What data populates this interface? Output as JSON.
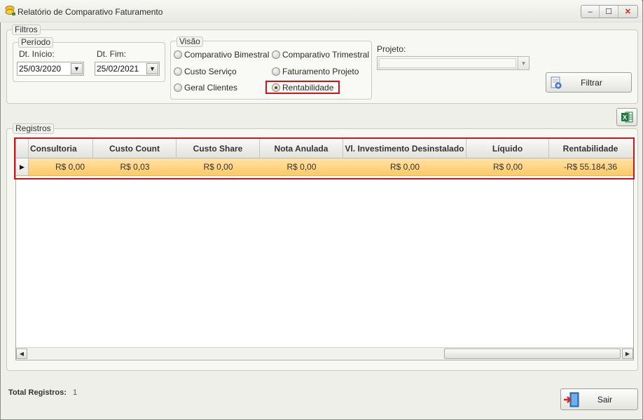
{
  "window": {
    "title": "Relatório de Comparativo Faturamento",
    "controls": {
      "minimize": "–",
      "maximize": "☐",
      "close": "✕"
    }
  },
  "filtros": {
    "legend": "Filtros",
    "periodo": {
      "legend": "Período",
      "inicio_label": "Dt. Início:",
      "inicio_value": "25/03/2020",
      "fim_label": "Dt. Fim:",
      "fim_value": "25/02/2021"
    },
    "visao": {
      "legend": "Visão",
      "options": [
        {
          "label": "Comparativo Bimestral",
          "selected": false
        },
        {
          "label": "Comparativo Trimestral",
          "selected": false
        },
        {
          "label": "Custo Serviço",
          "selected": false
        },
        {
          "label": "Faturamento Projeto",
          "selected": false
        },
        {
          "label": "Geral Clientes",
          "selected": false
        },
        {
          "label": "Rentabilidade",
          "selected": true
        }
      ]
    },
    "projeto": {
      "label": "Projeto:",
      "value": ""
    },
    "filtrar_label": "Filtrar"
  },
  "registros": {
    "legend": "Registros",
    "columns": [
      "Consultoria",
      "Custo Count",
      "Custo Share",
      "Nota Anulada",
      "Vl. Investimento Desinstalado",
      "Líquido",
      "Rentabilidade"
    ],
    "rows": [
      [
        "R$ 0,00",
        "R$ 0,03",
        "R$ 0,00",
        "R$ 0,00",
        "R$ 0,00",
        "R$ 0,00",
        "-R$ 55.184,36"
      ]
    ]
  },
  "footer": {
    "total_label": "Total Registros:",
    "total_value": "1",
    "sair_label": "Sair"
  },
  "colors": {
    "highlight_border": "#d4141c",
    "selected_row": "#ffc965",
    "window_bg": "#eeefe8"
  },
  "icons": {
    "app": "app-coins-icon",
    "filtrar": "filter-document-icon",
    "excel": "excel-export-icon",
    "sair": "exit-door-icon"
  }
}
